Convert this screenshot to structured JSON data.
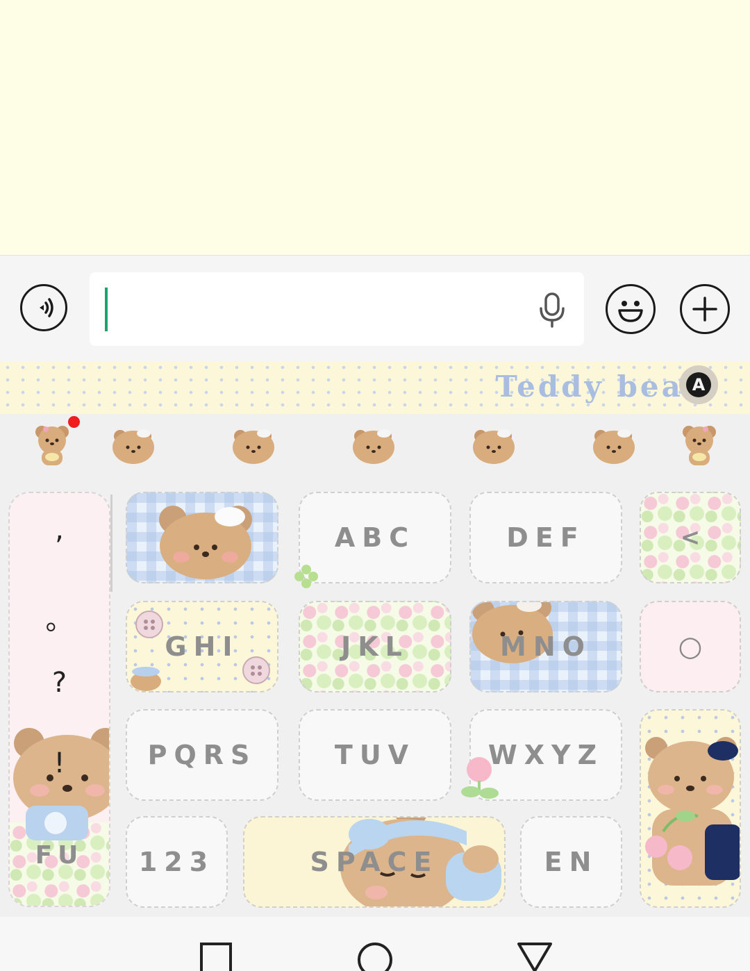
{
  "input": {
    "value": "",
    "placeholder": ""
  },
  "theme": {
    "title": "Teddy bear",
    "badge_letter": "A"
  },
  "stickers": [
    "bear-sticker",
    "bear-sticker",
    "bear-sticker",
    "bear-sticker",
    "bear-sticker",
    "bear-sticker",
    "bear-sticker"
  ],
  "keys": {
    "abc": "ABC",
    "def": "DEF",
    "backspace": "<",
    "ghi": "GHI",
    "jkl": "JKL",
    "mno": "MNO",
    "clear": "○",
    "pqrs": "PQRS",
    "tuv": "TUV",
    "wxyz": "WXYZ",
    "fu": "FU",
    "num": "123",
    "space": "SPACE",
    "lang": "EN"
  },
  "punctuation": [
    ",",
    "。",
    "?",
    "!"
  ],
  "colors": {
    "chat_bg": "#fefde5",
    "cursor": "#1ea36a",
    "theme_text": "#a9bde0",
    "notify": "#ef1d1d",
    "key_text": "#8e8e8e"
  }
}
